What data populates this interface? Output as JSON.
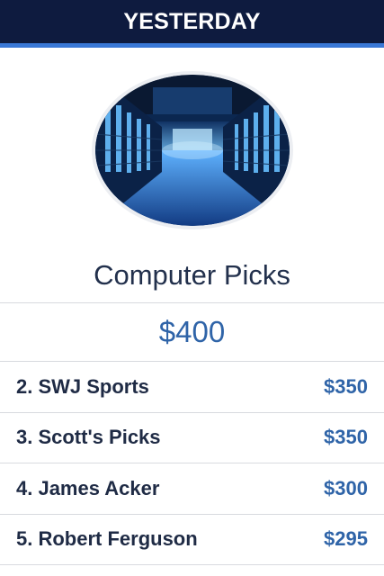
{
  "header": {
    "title": "YESTERDAY"
  },
  "hero": {
    "image_icon": "server-room-image"
  },
  "section": {
    "title": "Computer Picks",
    "amount": "$400"
  },
  "rankings": [
    {
      "label": "2. SWJ Sports",
      "amount": "$350"
    },
    {
      "label": "3. Scott's Picks",
      "amount": "$350"
    },
    {
      "label": "4. James Acker",
      "amount": "$300"
    },
    {
      "label": "5. Robert Ferguson",
      "amount": "$295"
    }
  ],
  "colors": {
    "header_bg": "#0e1b3f",
    "accent": "#3a78d6",
    "amount": "#2f64a8",
    "text": "#1f2b45"
  }
}
